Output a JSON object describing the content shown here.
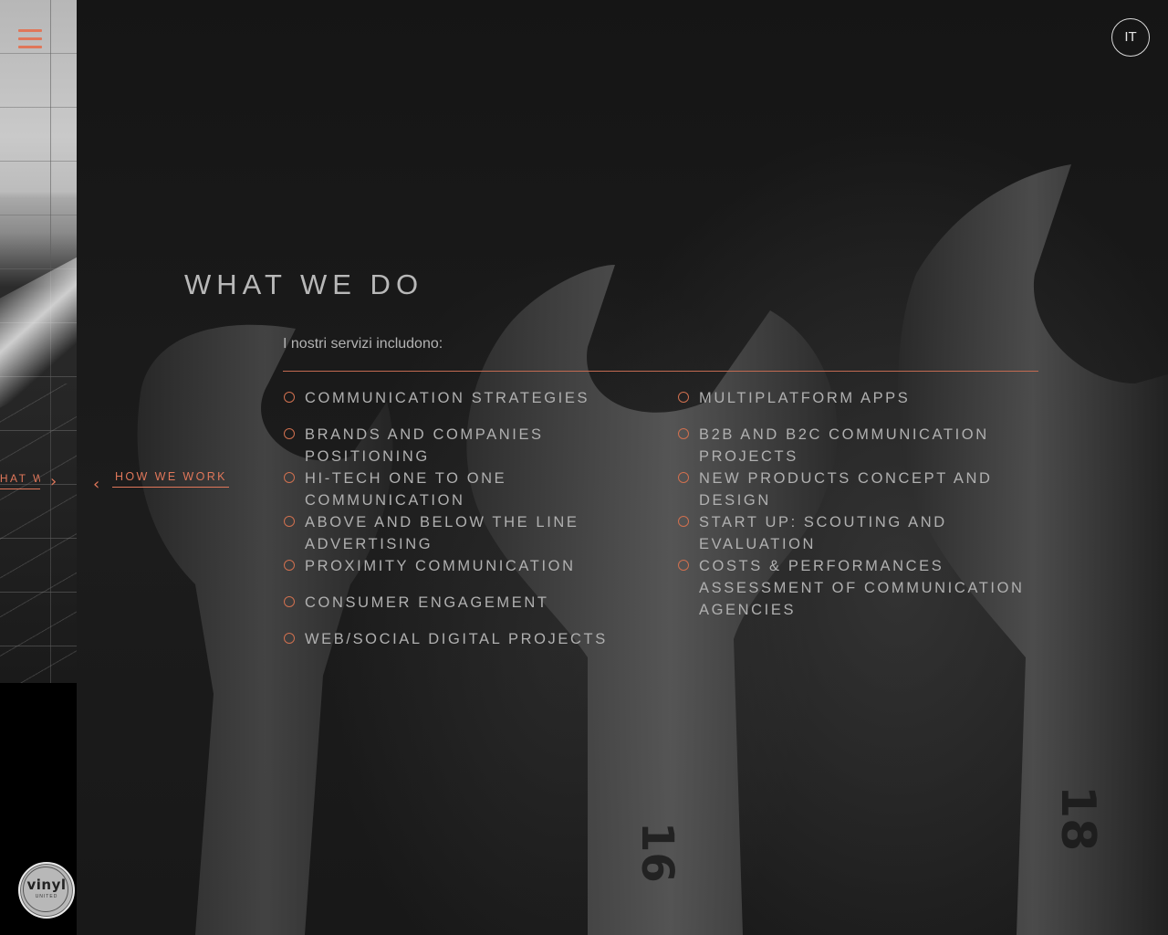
{
  "menu": {
    "icon": "hamburger-menu-icon"
  },
  "language": {
    "label": "IT"
  },
  "side_nav": {
    "next_label": "WHAT WE DO",
    "next_icon": "chevron-right-icon"
  },
  "nav": {
    "prev_label": "HOW WE WORK",
    "prev_icon": "chevron-left-icon"
  },
  "page": {
    "title": "WHAT WE DO",
    "intro": "I nostri servizi includono:"
  },
  "services": {
    "left": [
      "COMMUNICATION STRATEGIES",
      "BRANDS AND COMPANIES POSITIONING",
      "HI-TECH ONE TO ONE COMMUNICATION",
      "ABOVE AND BELOW THE LINE ADVERTISING",
      "PROXIMITY COMMUNICATION",
      "CONSUMER ENGAGEMENT",
      "WEB/SOCIAL DIGITAL PROJECTS"
    ],
    "right": [
      "MULTIPLATFORM APPS",
      "B2B AND B2C COMMUNICATION PROJECTS",
      "NEW PRODUCTS CONCEPT AND DESIGN",
      "START UP: SCOUTING AND EVALUATION",
      "COSTS & PERFORMANCES ASSESSMENT OF COMMUNICATION AGENCIES"
    ]
  },
  "logo": {
    "word": "vinyl",
    "sub": "UNITED"
  },
  "colors": {
    "accent": "#e0775a",
    "text": "#b0b0b0",
    "background": "#151515"
  }
}
